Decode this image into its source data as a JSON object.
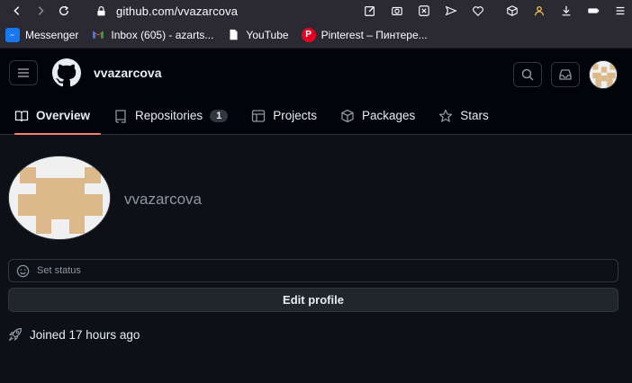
{
  "browser": {
    "url": "github.com/vvazarcova",
    "bookmarks": [
      {
        "label": "Messenger",
        "color": "#1877f2"
      },
      {
        "label": "Inbox (605) - azarts...",
        "color": "#ea4335"
      },
      {
        "label": "YouTube",
        "color": "#ffffff"
      },
      {
        "label": "Pinterest – Пинтере...",
        "color": "#e60023"
      }
    ]
  },
  "header": {
    "username": "vvazarcova"
  },
  "tabs": [
    {
      "label": "Overview",
      "active": true
    },
    {
      "label": "Repositories",
      "count": "1"
    },
    {
      "label": "Projects"
    },
    {
      "label": "Packages"
    },
    {
      "label": "Stars"
    }
  ],
  "profile": {
    "login": "vvazarcova",
    "status_placeholder": "Set status",
    "edit_label": "Edit profile",
    "joined": "Joined 17 hours ago"
  },
  "colors": {
    "accent_underline": "#f78166",
    "avatar_tan": "#dcb98a",
    "avatar_bg": "#f0f0f0"
  }
}
